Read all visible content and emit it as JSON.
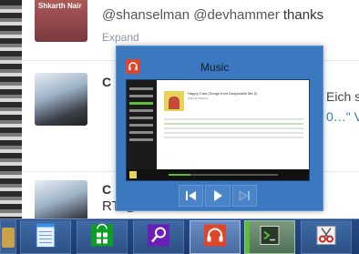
{
  "feed": {
    "tweet1": {
      "avatar_name": "Shkarth Nair",
      "mention1": "@shanselman",
      "mention2": "@devhammer",
      "text": " thanks",
      "expand": "Expand"
    },
    "tweet2": {
      "initial": "C",
      "line1": "Eich s",
      "line2": "0…\" V"
    },
    "tweet3": {
      "initial": "C",
      "text": "RT @shanselman: Azure Websites"
    }
  },
  "preview": {
    "title": "Music",
    "album_title": "Happy Cars (Songs from Despicable Me 2)",
    "album_sub": "Pharrell Williams"
  },
  "taskbar": {
    "items": [
      {
        "name": "explorer-partial"
      },
      {
        "name": "notepad"
      },
      {
        "name": "windows-store"
      },
      {
        "name": "search"
      },
      {
        "name": "music"
      },
      {
        "name": "terminal"
      },
      {
        "name": "snipping-tool"
      }
    ]
  },
  "colors": {
    "preview_bg": "#3a78bf",
    "music_accent": "#e0452b",
    "store_green": "#0c9d24",
    "search_purple": "#6a1fb5",
    "terminal_green": "#5dbb3c"
  }
}
